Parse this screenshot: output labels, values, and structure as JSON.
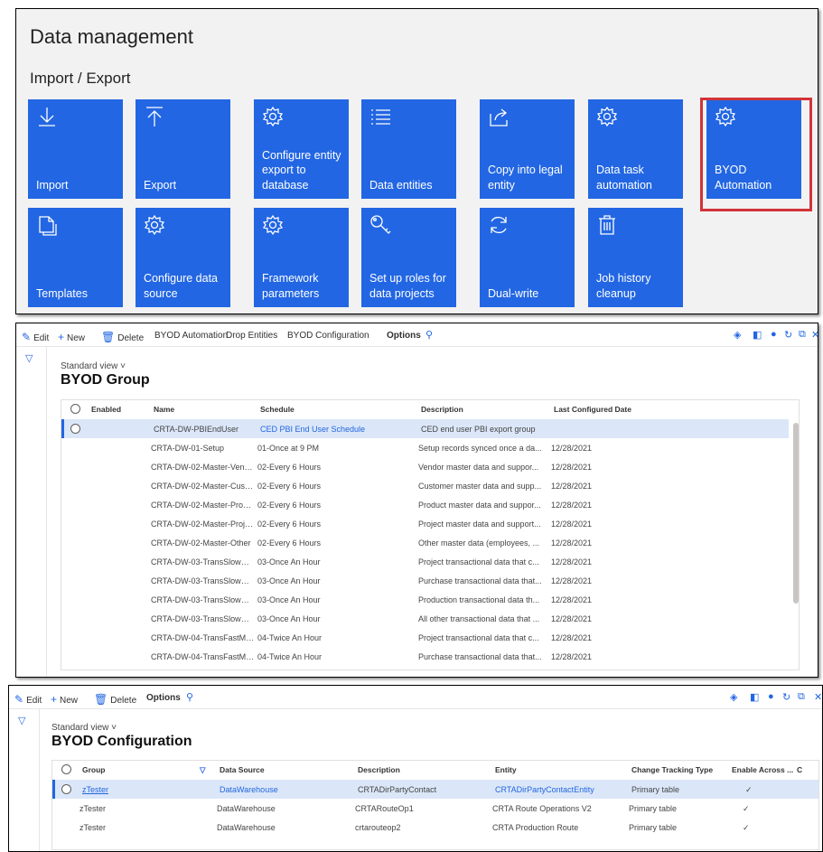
{
  "data_management": {
    "title": "Data management",
    "section": "Import / Export",
    "tiles": [
      {
        "label": "Import",
        "icon": "download-icon"
      },
      {
        "label": "Export",
        "icon": "upload-icon"
      },
      {
        "label": "Configure entity export to database",
        "icon": "gear-icon"
      },
      {
        "label": "Data entities",
        "icon": "list-icon"
      },
      {
        "label": "Copy into legal entity",
        "icon": "share-icon"
      },
      {
        "label": "Data task automation",
        "icon": "gear-icon"
      },
      {
        "label": "BYOD Automation",
        "icon": "gear-icon"
      },
      {
        "label": "Templates",
        "icon": "copy-icon"
      },
      {
        "label": "Configure data source",
        "icon": "gear-icon"
      },
      {
        "label": "Framework parameters",
        "icon": "gear-icon"
      },
      {
        "label": "Set up roles for data projects",
        "icon": "key-icon"
      },
      {
        "label": "Dual-write",
        "icon": "sync-icon"
      },
      {
        "label": "Job history cleanup",
        "icon": "trash-icon"
      }
    ],
    "tile_color": "#2266e3",
    "highlight_color": "#d13438"
  },
  "byod_group": {
    "actions": {
      "edit": "Edit",
      "new": "New",
      "delete": "Delete",
      "byod_automation": "BYOD Automation",
      "drop_entities": "Drop Entities",
      "byod_configuration": "BYOD Configuration",
      "options": "Options"
    },
    "view": "Standard view",
    "title": "BYOD Group",
    "columns": {
      "enabled": "Enabled",
      "name": "Name",
      "schedule": "Schedule",
      "description": "Description",
      "last_configured": "Last Configured Date"
    },
    "rows": [
      {
        "name": "CRTA-DW-PBIEndUser",
        "schedule": "CED PBI End User Schedule",
        "description": "CED end user PBI export group",
        "date": ""
      },
      {
        "name": "CRTA-DW-01-Setup",
        "schedule": "01-Once at 9 PM",
        "description": "Setup records synced once a da...",
        "date": "12/28/2021"
      },
      {
        "name": "CRTA-DW-02-Master-Vendor",
        "schedule": "02-Every 6 Hours",
        "description": "Vendor master data and suppor...",
        "date": "12/28/2021"
      },
      {
        "name": "CRTA-DW-02-Master-Customer",
        "schedule": "02-Every 6 Hours",
        "description": "Customer master data and supp...",
        "date": "12/28/2021"
      },
      {
        "name": "CRTA-DW-02-Master-Product",
        "schedule": "02-Every 6 Hours",
        "description": "Product master data and suppor...",
        "date": "12/28/2021"
      },
      {
        "name": "CRTA-DW-02-Master-Project",
        "schedule": "02-Every 6 Hours",
        "description": "Project master data and support...",
        "date": "12/28/2021"
      },
      {
        "name": "CRTA-DW-02-Master-Other",
        "schedule": "02-Every 6 Hours",
        "description": "Other master data (employees, ...",
        "date": "12/28/2021"
      },
      {
        "name": "CRTA-DW-03-TransSlowMoving...",
        "schedule": "03-Once An Hour",
        "description": "Project transactional data that c...",
        "date": "12/28/2021"
      },
      {
        "name": "CRTA-DW-03-TransSlowMoving...",
        "schedule": "03-Once An Hour",
        "description": "Purchase transactional data that...",
        "date": "12/28/2021"
      },
      {
        "name": "CRTA-DW-03-TransSlowMoving...",
        "schedule": "03-Once An Hour",
        "description": "Production transactional data th...",
        "date": "12/28/2021"
      },
      {
        "name": "CRTA-DW-03-TransSlowMoving...",
        "schedule": "03-Once An Hour",
        "description": "All other transactional data that ...",
        "date": "12/28/2021"
      },
      {
        "name": "CRTA-DW-04-TransFastMoving-...",
        "schedule": "04-Twice An Hour",
        "description": "Project transactional data that c...",
        "date": "12/28/2021"
      },
      {
        "name": "CRTA-DW-04-TransFastMoving-...",
        "schedule": "04-Twice An Hour",
        "description": "Purchase transactional data that...",
        "date": "12/28/2021"
      }
    ]
  },
  "byod_config": {
    "actions": {
      "edit": "Edit",
      "new": "New",
      "delete": "Delete",
      "options": "Options"
    },
    "view": "Standard view",
    "title": "BYOD Configuration",
    "columns": {
      "group": "Group",
      "data_source": "Data Source",
      "description": "Description",
      "entity": "Entity",
      "change_tracking": "Change Tracking Type",
      "enable_across": "Enable Across ...",
      "extra": "C"
    },
    "rows": [
      {
        "group": "zTester",
        "data_source": "DataWarehouse",
        "description": "CRTADirPartyContact",
        "entity": "CRTADirPartyContactEntity",
        "change_tracking": "Primary table",
        "enable_across": "✓"
      },
      {
        "group": "zTester",
        "data_source": "DataWarehouse",
        "description": "CRTARouteOp1",
        "entity": "CRTA Route Operations V2",
        "change_tracking": "Primary table",
        "enable_across": "✓"
      },
      {
        "group": "zTester",
        "data_source": "DataWarehouse",
        "description": "crtarouteop2",
        "entity": "CRTA Production Route",
        "change_tracking": "Primary table",
        "enable_across": "✓"
      }
    ]
  }
}
